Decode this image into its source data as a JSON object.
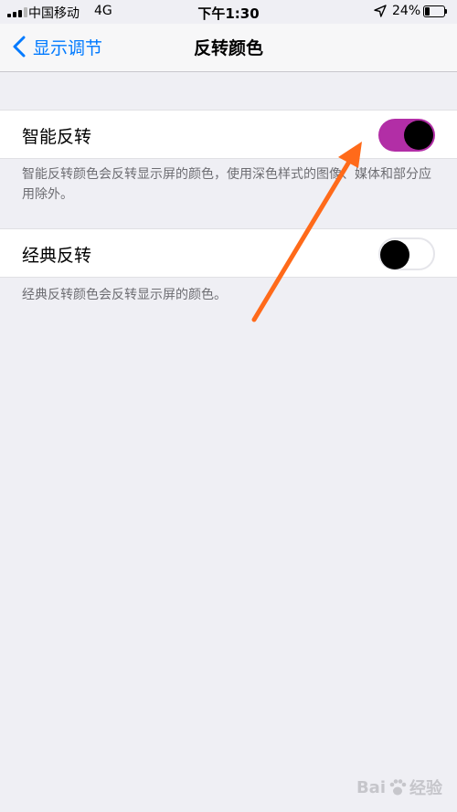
{
  "status_bar": {
    "carrier": "中国移动",
    "network": "4G",
    "time": "下午1:30",
    "battery_percent": "24%",
    "battery_level": 0.24,
    "signal_bars_filled": 3,
    "signal_bars_total": 4
  },
  "nav": {
    "back_label": "显示调节",
    "title": "反转颜色",
    "accent_color": "#007aff"
  },
  "settings": {
    "smart_invert": {
      "label": "智能反转",
      "enabled": true,
      "toggle_color": "#b22ea6",
      "description": "智能反转颜色会反转显示屏的颜色，使用深色样式的图像、媒体和部分应用除外。"
    },
    "classic_invert": {
      "label": "经典反转",
      "enabled": false,
      "description": "经典反转颜色会反转显示屏的颜色。"
    }
  },
  "annotation": {
    "arrow_color": "#ff6a1a"
  },
  "watermark": {
    "text_left": "Bai",
    "text_right": "经验"
  }
}
